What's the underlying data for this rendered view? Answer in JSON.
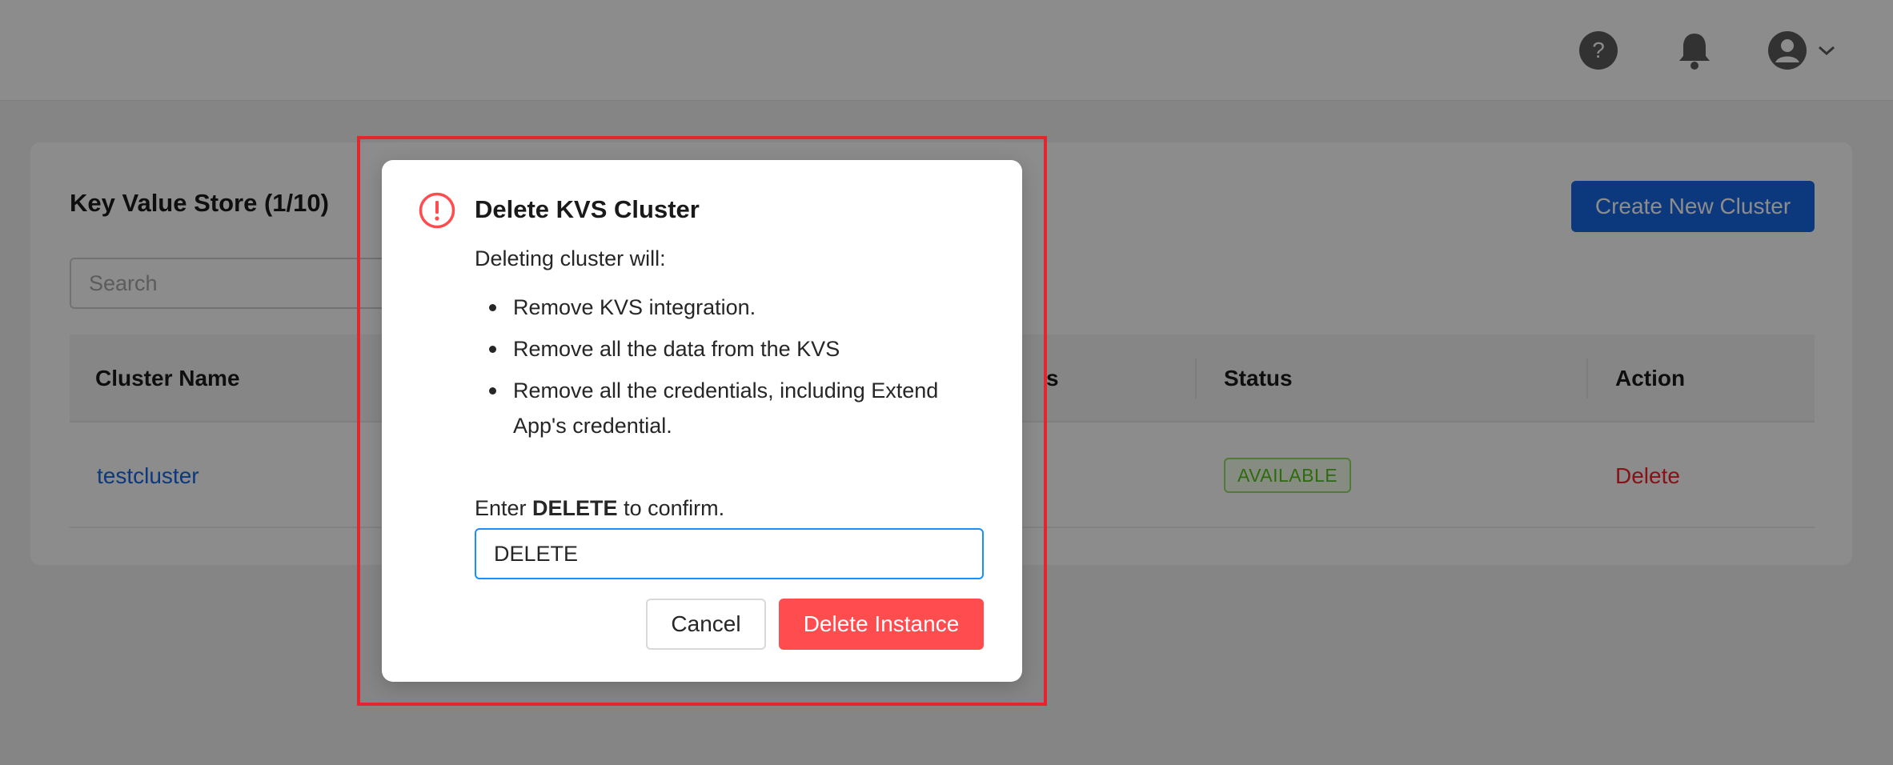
{
  "header": {
    "icons": [
      "question-circle-icon",
      "bell-icon",
      "user-avatar-icon",
      "chevron-down-icon"
    ]
  },
  "page": {
    "title": "Key Value Store (1/10)",
    "create_button": "Create New Cluster",
    "search": {
      "placeholder": "Search",
      "value": ""
    },
    "table": {
      "columns": [
        "Cluster Name",
        "s",
        "Status",
        "Action"
      ],
      "rows": [
        {
          "cluster_name": "testcluster",
          "status": "AVAILABLE",
          "action": "Delete"
        }
      ]
    }
  },
  "modal": {
    "title": "Delete KVS Cluster",
    "intro": "Deleting cluster will:",
    "items": [
      "Remove KVS integration.",
      "Remove all the data from the KVS",
      "Remove all the credentials, including Extend App's credential."
    ],
    "confirm_prefix": "Enter ",
    "confirm_keyword": "DELETE",
    "confirm_suffix": " to confirm.",
    "confirm_value": "DELETE",
    "cancel_label": "Cancel",
    "delete_label": "Delete Instance"
  },
  "colors": {
    "primary": "#1668e3",
    "danger": "#ff4d4f",
    "success": "#52c41a",
    "highlight_border": "#e4252b"
  }
}
